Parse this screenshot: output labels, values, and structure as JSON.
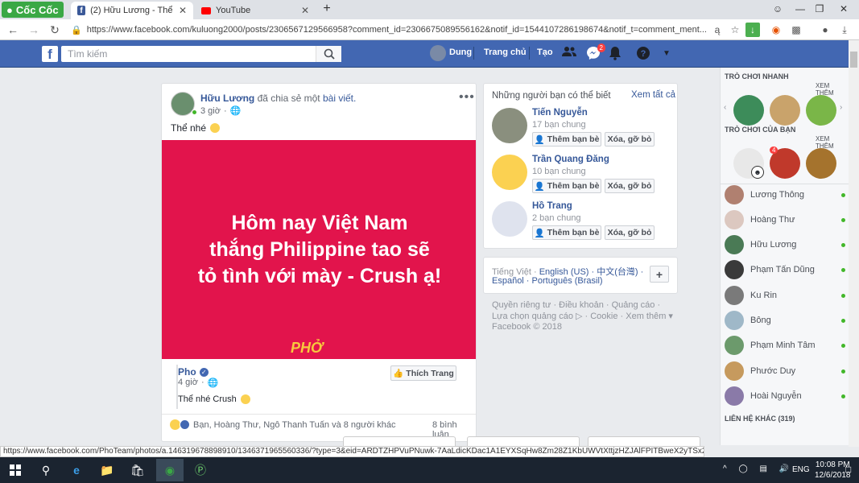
{
  "browser": {
    "brand": "Cốc Cốc",
    "tabs": [
      {
        "label": "(2) Hữu Lương - Thể nhé",
        "icon": "facebook-icon"
      },
      {
        "label": "YouTube",
        "icon": "youtube-icon"
      }
    ],
    "url": "https://www.facebook.com/kuluong2000/posts/2306567129566958?comment_id=2306675089556162&notif_id=1544107286198674&notif_t=comment_ment...",
    "status_url": "https://www.facebook.com/PhoTeam/photos/a.146319678898910/1346371965560336/?type=3&eid=ARDTZHPVuPNuwk-7AaLdicKDac1A1EYXSqHw8Zm28Z1KbUWVtXttjzHZJAlFPITBweX2yTSx2PYqRH0P&__xts__%5B0%5D=68.ARDy_APY16xDCq0FJZTU..."
  },
  "fb_header": {
    "search_placeholder": "Tìm kiếm",
    "user_name": "Dung",
    "home_label": "Trang chủ",
    "create_label": "Tạo",
    "messages_badge": "2"
  },
  "post": {
    "author": "Hữu Lương",
    "action": "đã chia sẻ một",
    "action_link": "bài viết.",
    "time": "3 giờ",
    "text": "Thể nhé",
    "banner_line1": "Hôm nay Việt Nam",
    "banner_line2": "thắng Philippine tao sẽ",
    "banner_line3": "tỏ tình với mày - Crush ạ!",
    "banner_logo": "PHỞ",
    "shared_page": "Pho",
    "shared_time": "4 giờ",
    "shared_text": "Thể nhé Crush",
    "like_page_label": "Thích Trang",
    "reactions_text": "Bạn, Hoàng Thư, Ngô Thanh Tuấn và 8 người khác",
    "comments_count": "8 bình luận"
  },
  "pymk": {
    "title": "Những người bạn có thể biết",
    "see_all": "Xem tất cả",
    "add_label": "Thêm bạn bè",
    "remove_label": "Xóa, gỡ bỏ",
    "people": [
      {
        "name": "Tiến Nguyễn",
        "mutual": "17 bạn chung"
      },
      {
        "name": "Trần Quang Đăng",
        "mutual": "10 bạn chung"
      },
      {
        "name": "Hồ Trang",
        "mutual": "2 bạn chung"
      }
    ]
  },
  "languages": {
    "line1": [
      "Tiếng Việt ·",
      "English (US) ·",
      "中文(台灣) ·"
    ],
    "line2": [
      "Español ·",
      "Português (Brasil)"
    ],
    "add": "+"
  },
  "footer": {
    "line1": "Quyền riêng tư · Điều khoản · Quảng cáo ·",
    "line2": "Lựa chọn quảng cáo ▷ · Cookie · Xem thêm ▾",
    "copyright": "Facebook © 2018"
  },
  "chat": {
    "quick_games": "TRÒ CHƠI NHANH",
    "see_more": "XEM THÊM",
    "your_games": "TRÒ CHƠI CỦA BẠN",
    "game_badge": "4",
    "contacts": [
      "Lương Thông",
      "Hoàng Thư",
      "Hữu Lương",
      "Phạm Tấn Dũng",
      "Ku Rin",
      "Bông",
      "Phạm Minh Tâm",
      "Phước Duy",
      "Hoài Nguyễn"
    ],
    "other_contacts": "LIÊN HỆ KHÁC (319)"
  },
  "taskbar": {
    "time": "10:08 PM",
    "date": "12/6/2018",
    "lang": "ENG"
  },
  "colors": {
    "fb_blue": "#4267b2",
    "banner_red": "#e2144c",
    "link": "#365899",
    "online": "#42b72a"
  }
}
